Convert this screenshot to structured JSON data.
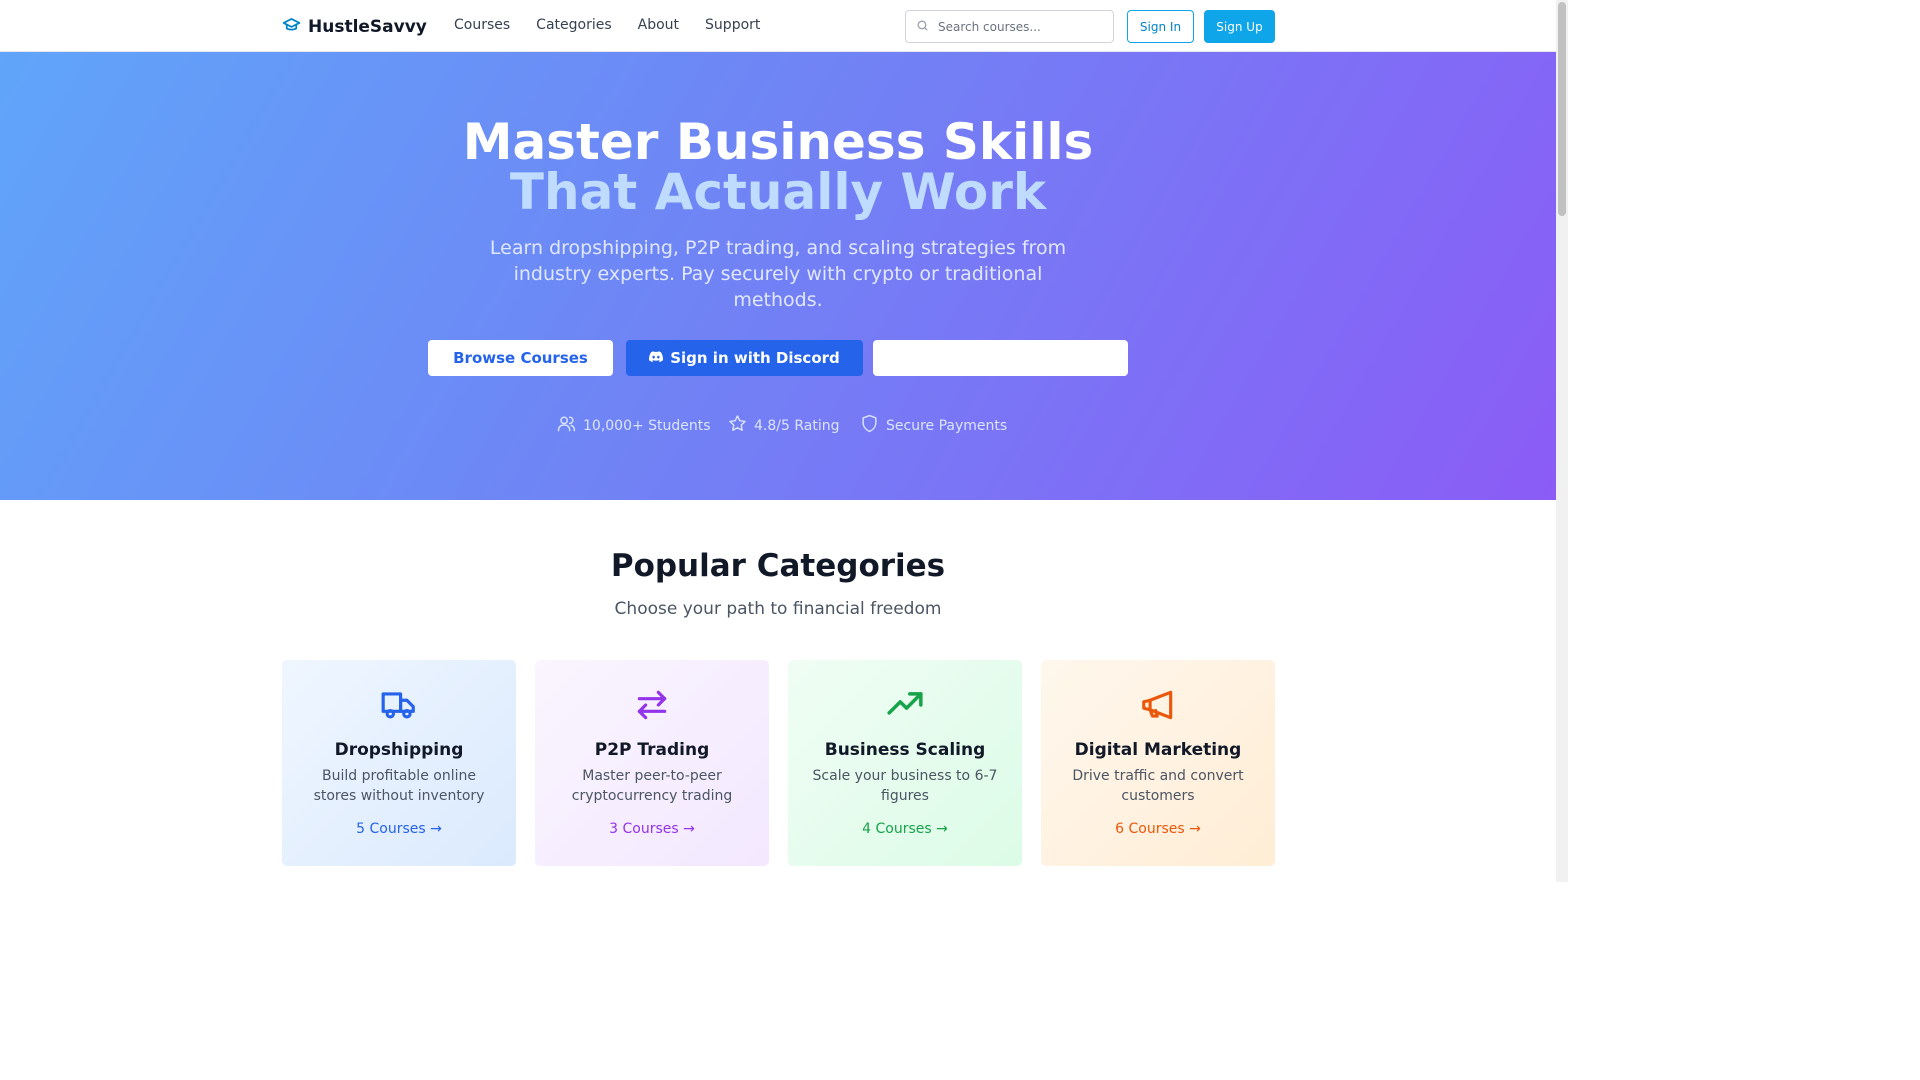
{
  "nav": {
    "brand": "HustleSavvy",
    "links": [
      {
        "label": "Courses"
      },
      {
        "label": "Categories"
      },
      {
        "label": "About"
      },
      {
        "label": "Support"
      }
    ],
    "search_placeholder": "Search courses...",
    "sign_in": "Sign In",
    "sign_up": "Sign Up"
  },
  "hero": {
    "title_line1": "Master Business Skills",
    "title_line2": "That Actually Work",
    "subtitle": "Learn dropshipping, P2P trading, and scaling strategies from industry experts. Pay securely with crypto or traditional methods.",
    "browse_button": "Browse Courses",
    "discord_button": "Sign in with Discord",
    "stats": [
      {
        "icon": "users-icon",
        "label": "10,000+ Students"
      },
      {
        "icon": "star-icon",
        "label": "4.8/5 Rating"
      },
      {
        "icon": "shield-icon",
        "label": "Secure Payments"
      }
    ]
  },
  "categories": {
    "title": "Popular Categories",
    "subtitle": "Choose your path to financial freedom",
    "items": [
      {
        "icon": "truck-icon",
        "title": "Dropshipping",
        "description": "Build profitable online stores without inventory",
        "link": "5 Courses →",
        "color": "#2563eb"
      },
      {
        "icon": "arrows-swap-icon",
        "title": "P2P Trading",
        "description": "Master peer-to-peer cryptocurrency trading",
        "link": "3 Courses →",
        "color": "#9333ea"
      },
      {
        "icon": "trending-up-icon",
        "title": "Business Scaling",
        "description": "Scale your business to 6-7 figures",
        "link": "4 Courses →",
        "color": "#16a34a"
      },
      {
        "icon": "megaphone-icon",
        "title": "Digital Marketing",
        "description": "Drive traffic and convert customers",
        "link": "6 Courses →",
        "color": "#ea580c"
      }
    ]
  },
  "colors": {
    "brand": "#0ea5e9",
    "hero_gradient_start": "#60a5fa",
    "hero_gradient_end": "#8b5cf6"
  }
}
